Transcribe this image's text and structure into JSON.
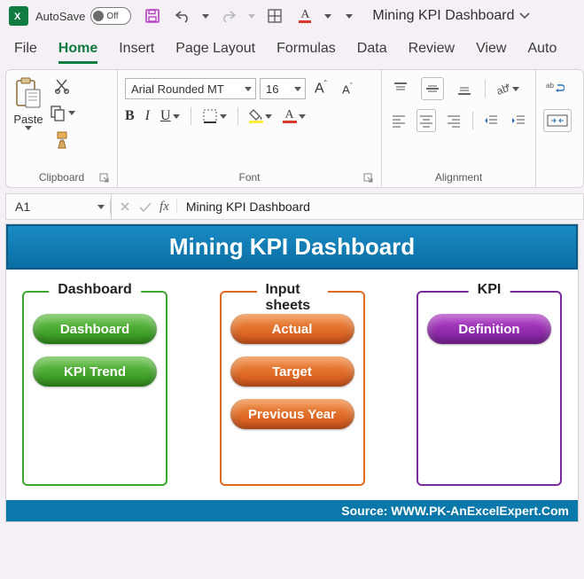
{
  "titlebar": {
    "autosave_label": "AutoSave",
    "autosave_state": "Off",
    "doc_title": "Mining KPI Dashboard"
  },
  "tabs": {
    "file": "File",
    "home": "Home",
    "insert": "Insert",
    "page_layout": "Page Layout",
    "formulas": "Formulas",
    "data": "Data",
    "review": "Review",
    "view": "View",
    "auto": "Auto"
  },
  "ribbon": {
    "clipboard": {
      "paste": "Paste",
      "label": "Clipboard"
    },
    "font": {
      "family": "Arial Rounded MT",
      "size": "16",
      "bold": "B",
      "italic": "I",
      "underline": "U",
      "fontcolor_letter": "A",
      "label": "Font"
    },
    "alignment": {
      "label": "Alignment"
    }
  },
  "fbar": {
    "cell": "A1",
    "fx": "fx",
    "formula": "Mining KPI Dashboard"
  },
  "sheet": {
    "title": "Mining KPI Dashboard",
    "cards": [
      {
        "legend": "Dashboard",
        "color": "green",
        "pills": [
          "Dashboard",
          "KPI Trend"
        ]
      },
      {
        "legend": "Input sheets",
        "color": "orange",
        "pills": [
          "Actual",
          "Target",
          "Previous Year"
        ]
      },
      {
        "legend": "KPI",
        "color": "purple",
        "pills": [
          "Definition"
        ]
      }
    ],
    "source": "Source: WWW.PK-AnExcelExpert.Com"
  }
}
